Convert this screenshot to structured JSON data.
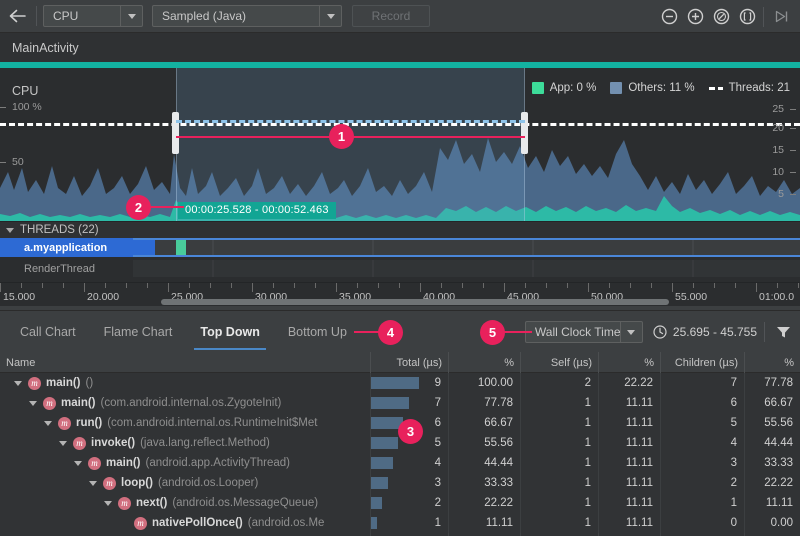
{
  "toolbar": {
    "back_icon": "arrow-left-icon",
    "process_select": {
      "value": "CPU",
      "arrow": "chevron-down-icon"
    },
    "mode_select": {
      "value": "Sampled (Java)",
      "arrow": "chevron-down-icon"
    },
    "record_button": "Record",
    "zoom_out_icon": "zoom-out-icon",
    "zoom_in_icon": "zoom-in-icon",
    "reset_zoom_icon": "reset-zoom-icon",
    "zoom_to_selection_icon": "zoom-to-selection-icon",
    "jump_to_end_icon": "jump-to-end-icon"
  },
  "session": {
    "activity_title": "MainActivity"
  },
  "cpu_chart": {
    "label": "CPU",
    "left_axis": [
      "100 %",
      "50"
    ],
    "right_axis": [
      "25",
      "20",
      "15",
      "10",
      "5"
    ],
    "legend": [
      {
        "name": "App: 0 %",
        "color": "#3ddc9a",
        "type": "swatch"
      },
      {
        "name": "Others: 11 %",
        "color": "#7390b0",
        "type": "swatch"
      },
      {
        "name": "Threads: 21",
        "color": "#ffffff",
        "type": "dash"
      }
    ],
    "selection_range": "00:00:25.528 - 00:00:52.463"
  },
  "threads": {
    "header": "THREADS (22)",
    "collapse_icon": "triangle-down-icon",
    "rows": [
      {
        "name": "a.myapplication",
        "selected": true
      },
      {
        "name": "RenderThread",
        "selected": false
      }
    ]
  },
  "timeline": {
    "ticks": [
      "15.000",
      "20.000",
      "25.000",
      "30.000",
      "35.000",
      "40.000",
      "45.000",
      "50.000",
      "55.000",
      "01:00.0"
    ]
  },
  "analysis_tabs": {
    "items": [
      {
        "label": "Call Chart",
        "active": false
      },
      {
        "label": "Flame Chart",
        "active": false
      },
      {
        "label": "Top Down",
        "active": true
      },
      {
        "label": "Bottom Up",
        "active": false
      }
    ],
    "clock_select": {
      "value": "Wall Clock Time",
      "arrow": "chevron-down-icon"
    },
    "range": {
      "icon": "clock-icon",
      "value": "25.695 - 45.755"
    },
    "filter_icon": "filter-icon"
  },
  "table": {
    "columns": [
      {
        "label": "Name",
        "align": "left"
      },
      {
        "label": "Total (µs)",
        "align": "right"
      },
      {
        "label": "%",
        "align": "right"
      },
      {
        "label": "Self (µs)",
        "align": "right"
      },
      {
        "label": "%",
        "align": "right"
      },
      {
        "label": "Children (µs)",
        "align": "right"
      },
      {
        "label": "%",
        "align": "right"
      }
    ],
    "rows": [
      {
        "depth": 0,
        "expanded": true,
        "icon": "method-icon",
        "fn": "main()",
        "pkg": "()",
        "total": "9",
        "total_pct": "100.00",
        "self": "2",
        "self_pct": "22.22",
        "children": "7",
        "children_pct": "77.78",
        "bar": 1.0
      },
      {
        "depth": 1,
        "expanded": true,
        "icon": "method-icon",
        "fn": "main()",
        "pkg": "(com.android.internal.os.ZygoteInit)",
        "total": "7",
        "total_pct": "77.78",
        "self": "1",
        "self_pct": "11.11",
        "children": "6",
        "children_pct": "66.67",
        "bar": 0.78
      },
      {
        "depth": 2,
        "expanded": true,
        "icon": "method-icon",
        "fn": "run()",
        "pkg": "(com.android.internal.os.RuntimeInit$Met",
        "total": "6",
        "total_pct": "66.67",
        "self": "1",
        "self_pct": "11.11",
        "children": "5",
        "children_pct": "55.56",
        "bar": 0.67
      },
      {
        "depth": 3,
        "expanded": true,
        "icon": "method-icon",
        "fn": "invoke()",
        "pkg": "(java.lang.reflect.Method)",
        "total": "5",
        "total_pct": "55.56",
        "self": "1",
        "self_pct": "11.11",
        "children": "4",
        "children_pct": "44.44",
        "bar": 0.56
      },
      {
        "depth": 4,
        "expanded": true,
        "icon": "method-icon",
        "fn": "main()",
        "pkg": "(android.app.ActivityThread)",
        "total": "4",
        "total_pct": "44.44",
        "self": "1",
        "self_pct": "11.11",
        "children": "3",
        "children_pct": "33.33",
        "bar": 0.44
      },
      {
        "depth": 5,
        "expanded": true,
        "icon": "method-icon",
        "fn": "loop()",
        "pkg": "(android.os.Looper)",
        "total": "3",
        "total_pct": "33.33",
        "self": "1",
        "self_pct": "11.11",
        "children": "2",
        "children_pct": "22.22",
        "bar": 0.33
      },
      {
        "depth": 6,
        "expanded": true,
        "icon": "method-icon",
        "fn": "next()",
        "pkg": "(android.os.MessageQueue)",
        "total": "2",
        "total_pct": "22.22",
        "self": "1",
        "self_pct": "11.11",
        "children": "1",
        "children_pct": "11.11",
        "bar": 0.22
      },
      {
        "depth": 7,
        "expanded": false,
        "icon": "method-icon",
        "fn": "nativePollOnce()",
        "pkg": "(android.os.Me",
        "total": "1",
        "total_pct": "11.11",
        "self": "1",
        "self_pct": "11.11",
        "children": "0",
        "children_pct": "0.00",
        "bar": 0.11
      }
    ]
  },
  "callouts": [
    {
      "id": "1",
      "label": "1"
    },
    {
      "id": "2",
      "label": "2"
    },
    {
      "id": "3",
      "label": "3"
    },
    {
      "id": "4",
      "label": "4"
    },
    {
      "id": "5",
      "label": "5"
    }
  ],
  "colors": {
    "accent_teal": "#13b2a1",
    "callout_pink": "#e8215c",
    "selection_blue": "#2d6ad4",
    "tab_underline": "#4a88c7",
    "app_series": "#3ddc9a",
    "others_series": "#7390b0"
  }
}
